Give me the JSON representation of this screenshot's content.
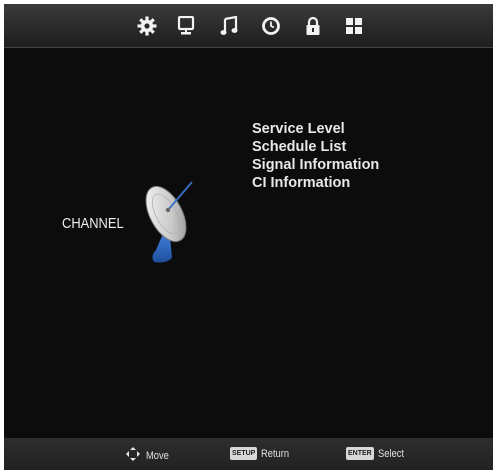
{
  "menu": {
    "items": [
      {
        "label": "Service Level"
      },
      {
        "label": "Schedule List"
      },
      {
        "label": "Signal Information"
      },
      {
        "label": "CI Information"
      }
    ]
  },
  "section": {
    "label": "CHANNEL",
    "icon": "satellite-dish-icon"
  },
  "tabs": [
    {
      "icon": "gear-icon"
    },
    {
      "icon": "monitor-icon"
    },
    {
      "icon": "music-note-icon"
    },
    {
      "icon": "clock-icon"
    },
    {
      "icon": "lock-icon"
    },
    {
      "icon": "grid-icon"
    }
  ],
  "footer": {
    "move": {
      "label": "Move",
      "icon": "arrows-icon"
    },
    "return": {
      "key": "SETUP",
      "label": "Return"
    },
    "select": {
      "key": "ENTER",
      "label": "Select"
    }
  },
  "colors": {
    "background": "#0c0c0c",
    "topbar": "#2c2c2c",
    "text": "#e8e8e8"
  }
}
